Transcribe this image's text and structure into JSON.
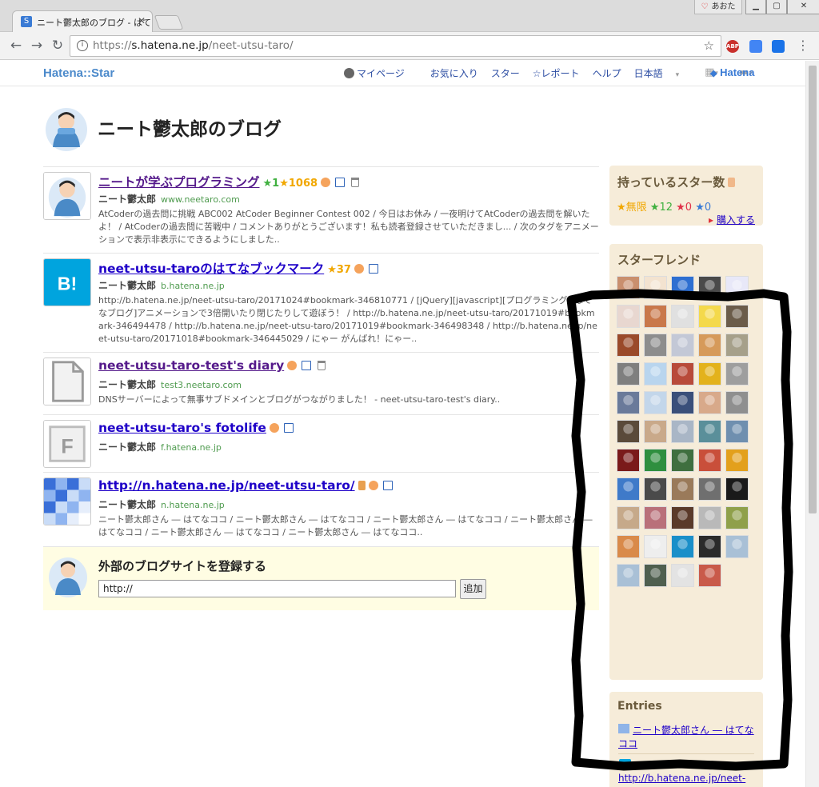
{
  "browser": {
    "tab_title": "ニート鬱太郎のブログ - はて",
    "tab_favicon": "S",
    "profile_label": "あおた",
    "url_scheme": "https://",
    "url_host": "s.hatena.ne.jp",
    "url_path": "/neet-utsu-taro/",
    "extensions": [
      "ABP",
      "",
      ""
    ]
  },
  "header": {
    "logo": "Hatena::Star",
    "nav": [
      "マイページ",
      "お気に入り",
      "スター",
      "☆レポート",
      "ヘルプ",
      "日本語"
    ],
    "hatena_logo": "Hatena"
  },
  "blog_title": "ニート鬱太郎のブログ",
  "entries": [
    {
      "title": "ニートが学ぶプログラミング",
      "stars": [
        {
          "mark": "★",
          "count": "1",
          "color": "green"
        },
        {
          "mark": "★",
          "count": "1068",
          "color": "orange"
        }
      ],
      "author": "ニート鬱太郎",
      "domain": "www.neetaro.com",
      "description": "AtCoderの過去問に挑戦 ABC002 AtCoder Beginner Contest 002 / 今日はお休み / 一夜明けてAtCoderの過去問を解いたよ！ / AtCoderの過去問に苦戦中 / コメントありがとうございます！私も読者登録させていただきまし... / 次のタグをアニメーションで表示非表示にできるようにしました.."
    },
    {
      "title": "neet-utsu-taroのはてなブックマーク",
      "stars": [
        {
          "mark": "★",
          "count": "37",
          "color": "orange"
        }
      ],
      "author": "ニート鬱太郎",
      "domain": "b.hatena.ne.jp",
      "description": "http://b.hatena.ne.jp/neet-utsu-taro/20171024#bookmark-346810771 / [jQuery][javascript][プログラミング][はてなブログ]アニメーションで3倍開いたり閉じたりして遊ぼう！ / http://b.hatena.ne.jp/neet-utsu-taro/20171019#bookmark-346494478 / http://b.hatena.ne.jp/neet-utsu-taro/20171019#bookmark-346498348 / http://b.hatena.ne.jp/neet-utsu-taro/20171018#bookmark-346445029 / にゃー がんばれ！にゃー.."
    },
    {
      "title": "neet-utsu-taro-test's diary",
      "stars": [],
      "author": "ニート鬱太郎",
      "domain": "test3.neetaro.com",
      "description": "DNSサーバーによって無事サブドメインとブログがつながりました！ - neet-utsu-taro-test's diary.."
    },
    {
      "title": "neet-utsu-taro's fotolife",
      "stars": [],
      "author": "ニート鬱太郎",
      "domain": "f.hatena.ne.jp",
      "description": ""
    },
    {
      "title": "http://n.hatena.ne.jp/neet-utsu-taro/",
      "stars": [],
      "author": "ニート鬱太郎",
      "domain": "n.hatena.ne.jp",
      "description": "ニート鬱太郎さん ― はてなココ / ニート鬱太郎さん ― はてなココ / ニート鬱太郎さん ― はてなココ / ニート鬱太郎さん ― はてなココ / ニート鬱太郎さん ― はてなココ / ニート鬱太郎さん ― はてなココ.."
    }
  ],
  "register": {
    "title": "外部のブログサイトを登録する",
    "input_value": "http://",
    "button_label": "追加"
  },
  "sidebar": {
    "stars_box": {
      "title": "持っているスター数",
      "unlimited": "★無限",
      "green": "★12",
      "red": "★0",
      "blue": "★0",
      "buy_label": "購入する"
    },
    "friends_box": {
      "title": "スターフレンド",
      "count": 54,
      "colors": [
        "#c98f6e",
        "#f3e3d0",
        "#2e6fd1",
        "#4a4a4a",
        "#e8e8f8",
        "#e8d7d0",
        "#c9784a",
        "#e0e0e0",
        "#f4d94b",
        "#6b5c4a",
        "#9a4a2a",
        "#8d8d8d",
        "#c3c8d6",
        "#d69a5a",
        "#a6a08a",
        "#7f7f7f",
        "#b9d5ee",
        "#b84a3a",
        "#e3b21c",
        "#9e9e9e",
        "#6a7a9a",
        "#c3d6ea",
        "#3a4f7a",
        "#d8a98a",
        "#8f8f8f",
        "#5a4a3a",
        "#c9a98a",
        "#a9b6c6",
        "#5a8f9a",
        "#6f8faf",
        "#7a1a1a",
        "#2f8f3f",
        "#3f6f3f",
        "#c94f3a",
        "#e3a01c",
        "#3f7ac9",
        "#4a4a4a",
        "#9a7a5a",
        "#6f6f6f",
        "#1a1a1a",
        "#c6a98a",
        "#b9707a",
        "#5a3a2a",
        "#b9b9b9",
        "#8fa04a",
        "#d98a4a",
        "#eeeeee",
        "#1a8fc9",
        "#2a2a2a",
        "#a9c0d6",
        "#a9c0d6",
        "#4f5f4f",
        "#e3e3e3",
        "#c95a4a"
      ]
    },
    "entries_box": {
      "title": "Entries",
      "entry1": "ニート鬱太郎さん ― はてなココ",
      "entry2": "http://b.hatena.ne.jp/neet-"
    }
  },
  "colors": {
    "link": "#1e00c8",
    "visited": "#551a8b",
    "sidebar_bg": "#f6ecd9",
    "register_bg": "#fffde3"
  }
}
